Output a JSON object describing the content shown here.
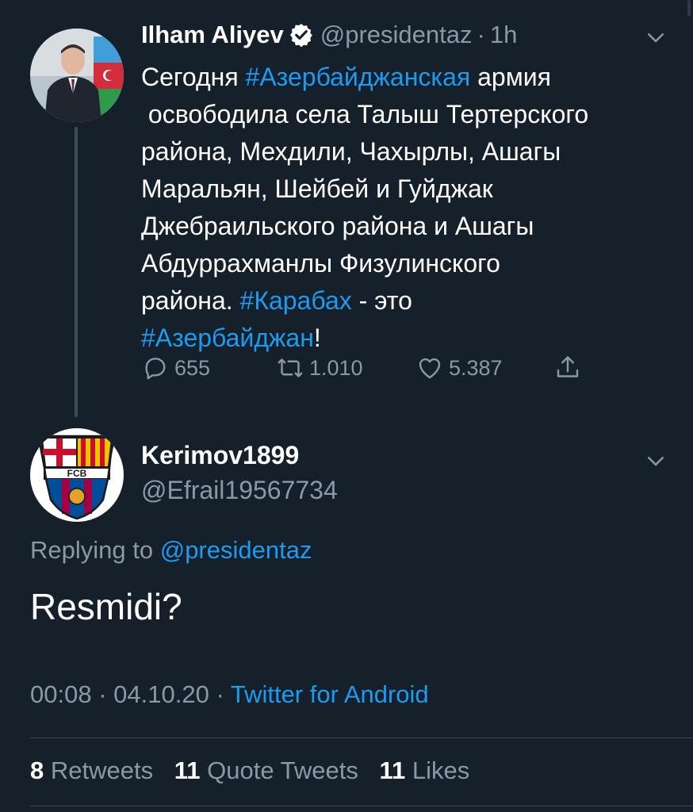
{
  "colors": {
    "background": "#15202b",
    "link": "#1d9bf0",
    "muted": "#8b98a5"
  },
  "parent_tweet": {
    "author_name": "Ilham Aliyev",
    "handle": "@presidentaz",
    "separator": "·",
    "time": "1h",
    "body_lines": [
      [
        {
          "text": "Сегодня "
        },
        {
          "text": "#Азербайджанская",
          "link": true
        },
        {
          "text": " армия"
        }
      ],
      [
        {
          "text": " освободила села Талыш Тертерского"
        }
      ],
      [
        {
          "text": "района, Мехдили, Чахырлы, Ашагы"
        }
      ],
      [
        {
          "text": "Маральян, Шейбей и Гуйджак"
        }
      ],
      [
        {
          "text": "Джебраильского района и Ашагы"
        }
      ],
      [
        {
          "text": "Абдуррахманлы Физулинского"
        }
      ],
      [
        {
          "text": "района. "
        },
        {
          "text": "#Карабах",
          "link": true
        },
        {
          "text": " - это"
        }
      ],
      [
        {
          "text": "#Азербайджан",
          "link": true
        },
        {
          "text": "!"
        }
      ]
    ],
    "replies": "655",
    "retweets": "1.010",
    "likes": "5.387",
    "icons": [
      "verified-badge-icon",
      "reply-icon",
      "retweet-icon",
      "like-icon",
      "share-icon",
      "chevron-down-icon"
    ]
  },
  "reply_tweet": {
    "author_name": "Kerimov1899",
    "handle": "@Efrail19567734",
    "replying_prefix": "Replying to",
    "replying_handle": "@presidentaz",
    "text": "Resmidi?",
    "time": "00:08",
    "date": "04.10.20",
    "separator": "·",
    "source": "Twitter for Android",
    "avatar_text": "FCB",
    "stats": {
      "retweets_count": "8",
      "retweets_label": "Retweets",
      "quotes_count": "11",
      "quotes_label": "Quote Tweets",
      "likes_count": "11",
      "likes_label": "Likes"
    }
  }
}
